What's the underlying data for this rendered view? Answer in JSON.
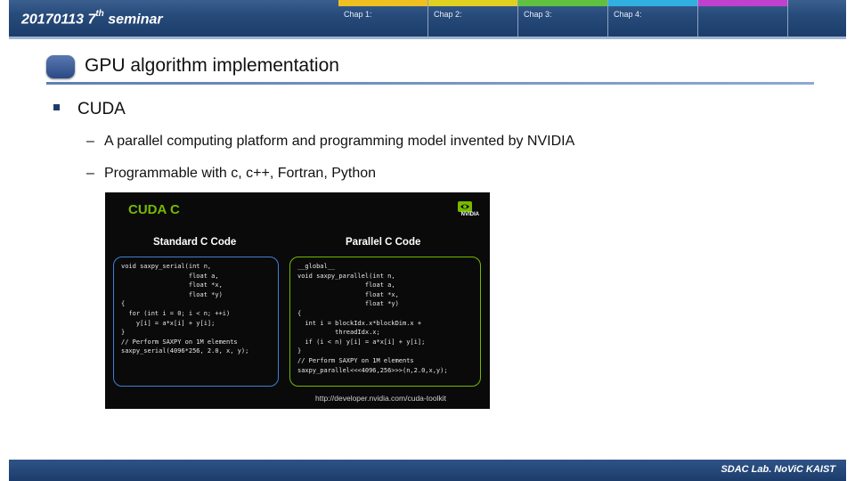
{
  "header": {
    "title": "20170113 7",
    "title_sup": "th",
    "title_suffix": " seminar",
    "tabs": [
      {
        "label": "Chap 1:",
        "color": "#f0c020"
      },
      {
        "label": "Chap 2:",
        "color": "#e0d020"
      },
      {
        "label": "Chap 3:",
        "color": "#60c040"
      },
      {
        "label": "Chap 4:",
        "color": "#30b0e0"
      },
      {
        "label": "",
        "color": "#c040d0"
      }
    ]
  },
  "slide": {
    "title": "GPU algorithm implementation",
    "bullet": "CUDA",
    "sub_bullets": [
      "A parallel computing platform and programming model invented by NVIDIA",
      "Programmable with c, c++, Fortran, Python"
    ]
  },
  "figure": {
    "title": "CUDA C",
    "logo_text": "NVIDIA",
    "left_heading": "Standard C Code",
    "right_heading": "Parallel C Code",
    "left_code": [
      "void saxpy_serial(int n,",
      "                  float a,",
      "                  float *x,",
      "                  float *y)",
      "{",
      "  for (int i = 0; i < n; ++i)",
      "    y[i] = a*x[i] + y[i];",
      "}",
      "// Perform SAXPY on 1M elements",
      "saxpy_serial(4096*256, 2.0, x, y);"
    ],
    "right_code": [
      "__global__",
      "void saxpy_parallel(int n,",
      "                  float a,",
      "                  float *x,",
      "                  float *y)",
      "{",
      "  int i = blockIdx.x*blockDim.x +",
      "          threadIdx.x;",
      "  if (i < n) y[i] = a*x[i] + y[i];",
      "}",
      "// Perform SAXPY on 1M elements",
      "saxpy_parallel<<<4096,256>>>(n,2.0,x,y);"
    ],
    "url": "http://developer.nvidia.com/cuda-toolkit"
  },
  "footer": {
    "text": "SDAC Lab. NoViC KAIST"
  }
}
